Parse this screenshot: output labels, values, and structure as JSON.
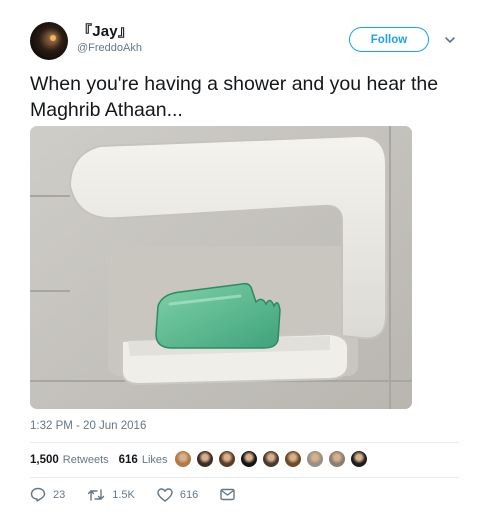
{
  "user": {
    "name": "『Jay』",
    "handle": "@FreddoAkh"
  },
  "follow_label": "Follow",
  "tweet": {
    "text": "When you're having a shower and you hear the Maghrib Athaan...",
    "timestamp": "1:32 PM - 20 Jun 2016"
  },
  "stats": {
    "retweets_count": "1,500",
    "retweets_label": "Retweets",
    "likes_count": "616",
    "likes_label": "Likes"
  },
  "actions": {
    "reply_count": "23",
    "retweet_count": "1.5K",
    "like_count": "616"
  },
  "colors": {
    "accent": "#1da1f2",
    "secondary_text": "#657786",
    "divider": "#e6ecf0"
  },
  "likers": [
    {
      "name": "liker-avatar-1",
      "color": "#b07a4a"
    },
    {
      "name": "liker-avatar-2",
      "color": "#3a2d26"
    },
    {
      "name": "liker-avatar-3",
      "color": "#5a3b2a"
    },
    {
      "name": "liker-avatar-4",
      "color": "#151515"
    },
    {
      "name": "liker-avatar-5",
      "color": "#4b3a2e"
    },
    {
      "name": "liker-avatar-6",
      "color": "#6d4a2a"
    },
    {
      "name": "liker-avatar-7",
      "color": "#9a8f88"
    },
    {
      "name": "liker-avatar-8",
      "color": "#8c7d74"
    },
    {
      "name": "liker-avatar-9",
      "color": "#1e1e1e"
    }
  ],
  "icons": {
    "chevron": "chevron-down-icon",
    "reply": "reply-icon",
    "retweet": "retweet-icon",
    "like": "heart-icon",
    "dm": "direct-message-icon"
  }
}
